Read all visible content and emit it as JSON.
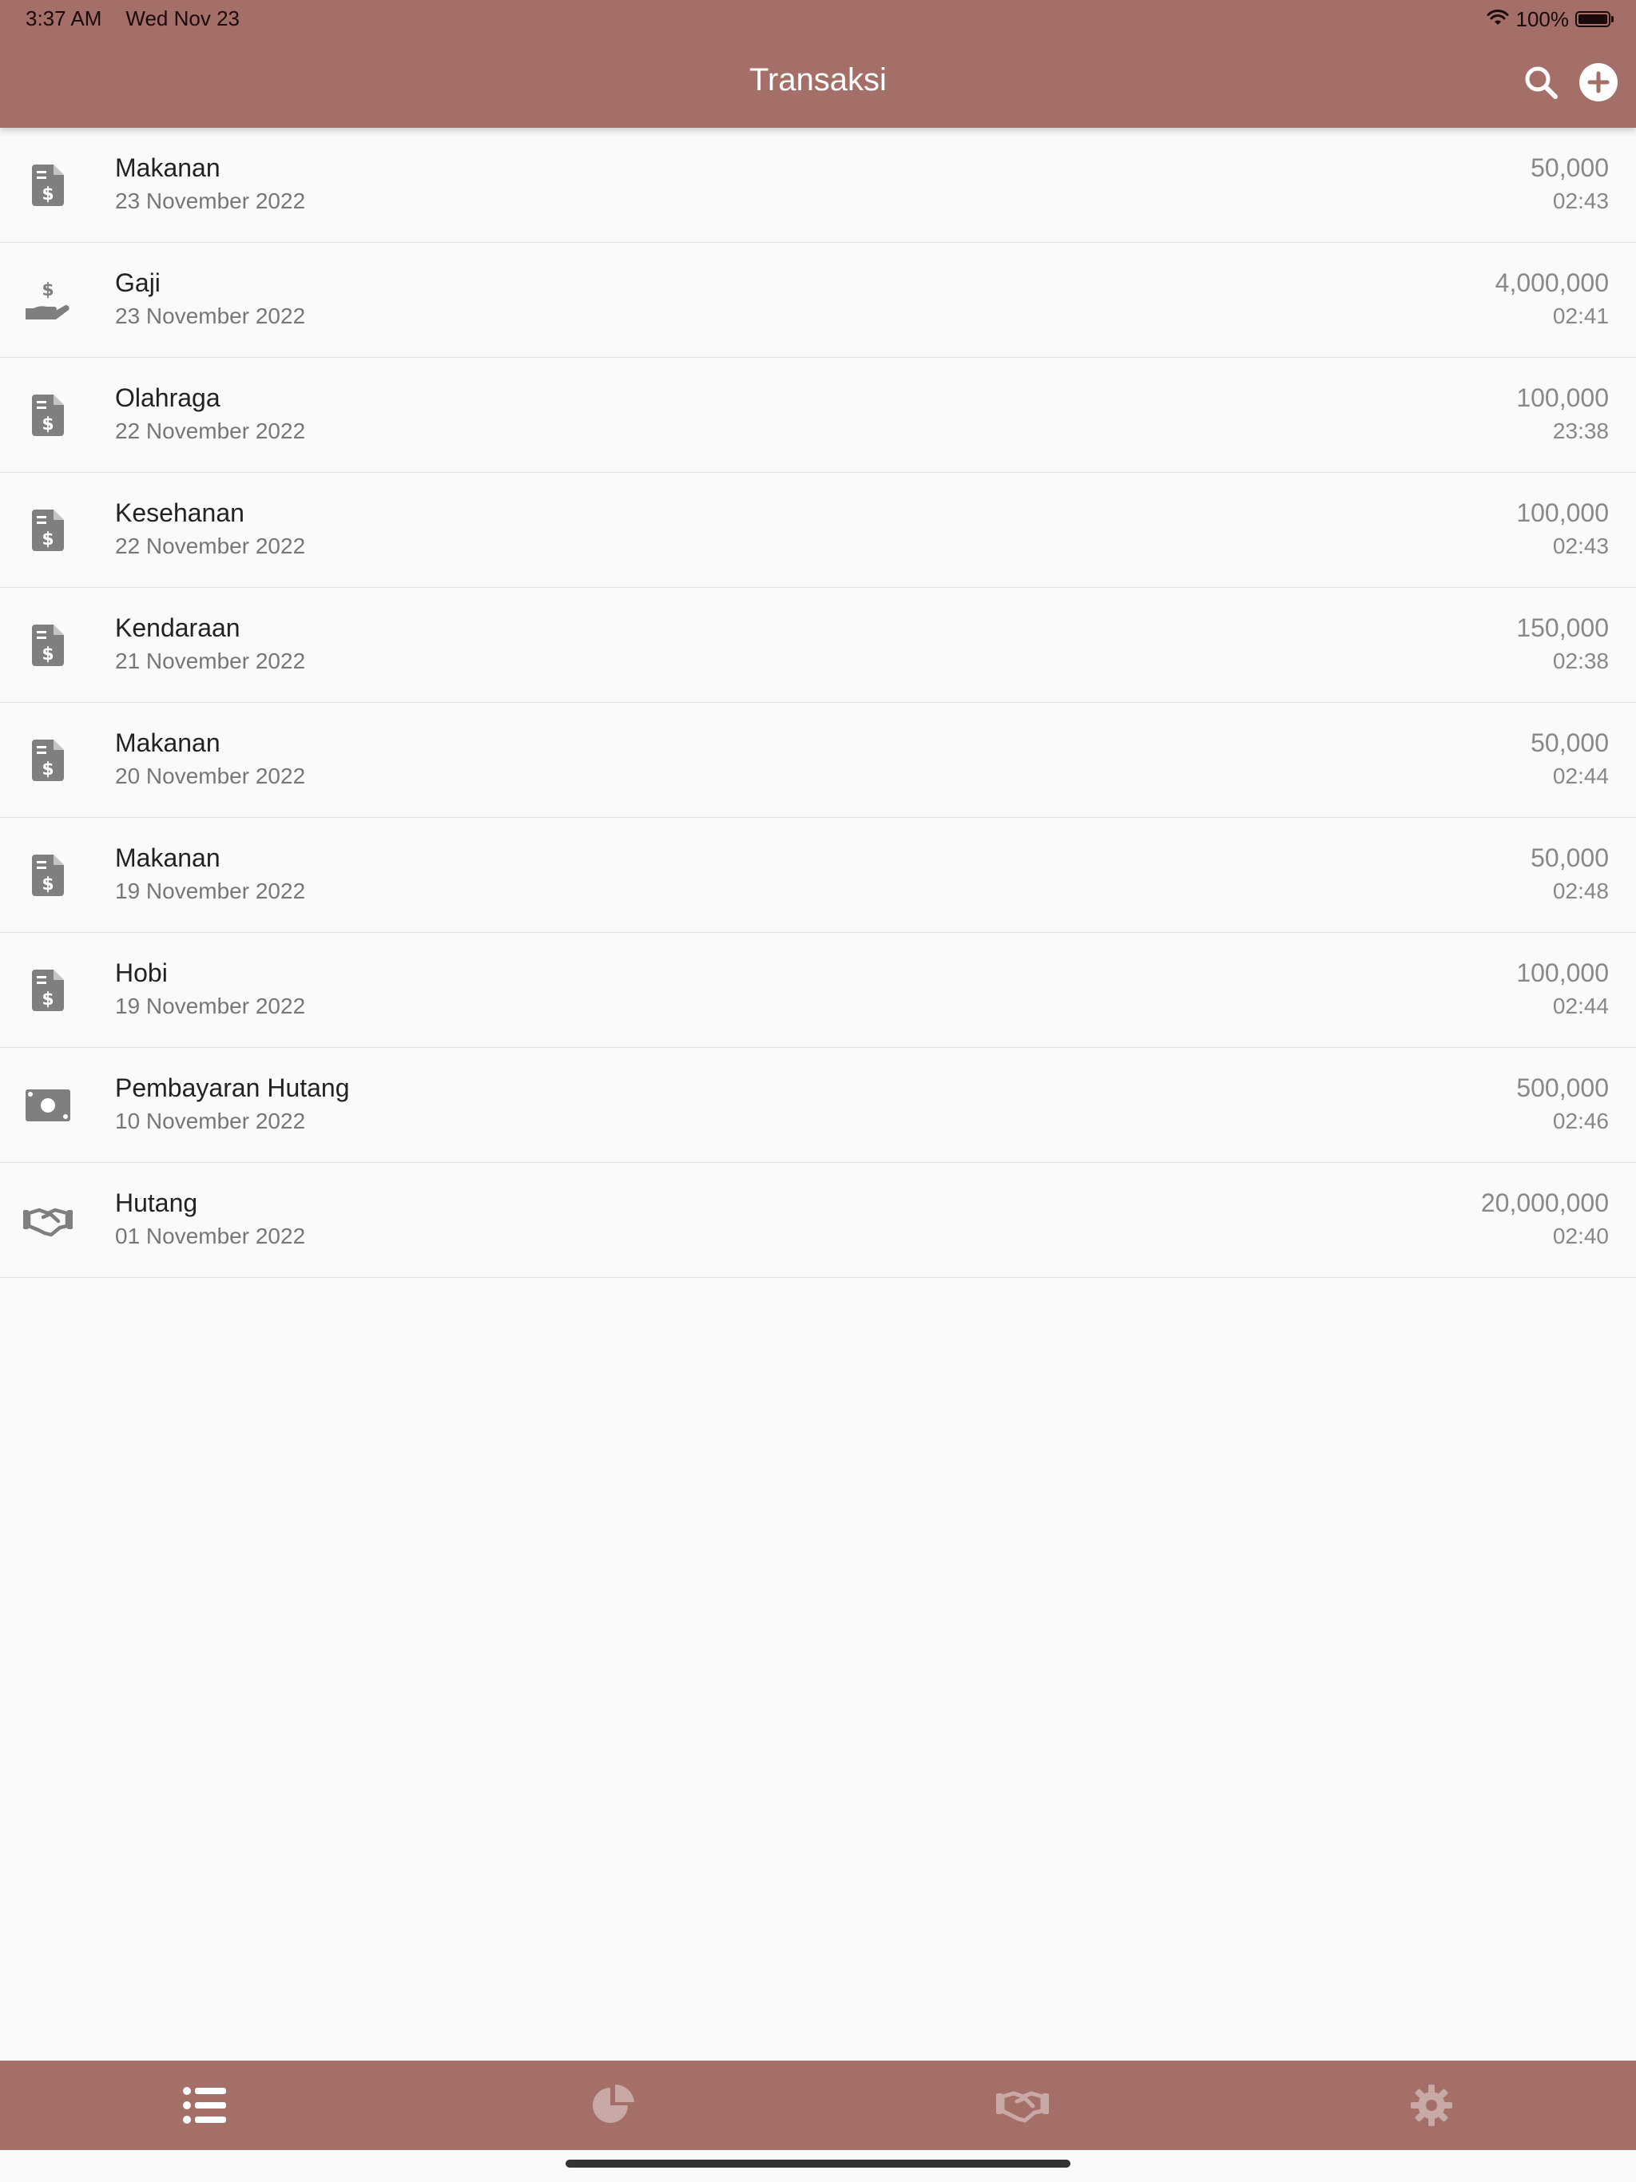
{
  "status_bar": {
    "time": "3:37 AM",
    "date": "Wed Nov 23",
    "battery": "100%"
  },
  "nav": {
    "title": "Transaksi",
    "actions": [
      "search-icon",
      "add-circle-icon"
    ]
  },
  "transactions": [
    {
      "icon": "receipt-dollar-icon",
      "title": "Makanan",
      "date": "23 November 2022",
      "amount": "50,000",
      "time": "02:43"
    },
    {
      "icon": "hand-holding-dollar-icon",
      "title": "Gaji",
      "date": "23 November 2022",
      "amount": "4,000,000",
      "time": "02:41"
    },
    {
      "icon": "receipt-dollar-icon",
      "title": "Olahraga",
      "date": "22 November 2022",
      "amount": "100,000",
      "time": "23:38"
    },
    {
      "icon": "receipt-dollar-icon",
      "title": "Kesehanan",
      "date": "22 November 2022",
      "amount": "100,000",
      "time": "02:43"
    },
    {
      "icon": "receipt-dollar-icon",
      "title": "Kendaraan",
      "date": "21 November 2022",
      "amount": "150,000",
      "time": "02:38"
    },
    {
      "icon": "receipt-dollar-icon",
      "title": "Makanan",
      "date": "20 November 2022",
      "amount": "50,000",
      "time": "02:44"
    },
    {
      "icon": "receipt-dollar-icon",
      "title": "Makanan",
      "date": "19 November 2022",
      "amount": "50,000",
      "time": "02:48"
    },
    {
      "icon": "receipt-dollar-icon",
      "title": "Hobi",
      "date": "19 November 2022",
      "amount": "100,000",
      "time": "02:44"
    },
    {
      "icon": "money-bill-icon",
      "title": "Pembayaran Hutang",
      "date": "10 November 2022",
      "amount": "500,000",
      "time": "02:46"
    },
    {
      "icon": "handshake-icon",
      "title": "Hutang",
      "date": "01 November 2022",
      "amount": "20,000,000",
      "time": "02:40"
    }
  ],
  "tabs": [
    {
      "icon": "list-icon",
      "active": true
    },
    {
      "icon": "pie-chart-icon",
      "active": false
    },
    {
      "icon": "handshake-icon",
      "active": false
    },
    {
      "icon": "gear-icon",
      "active": false
    }
  ],
  "colors": {
    "bar": "#a46f69",
    "background": "#fafafa",
    "icon": "#7f7f7f",
    "tab_active": "#ffffff",
    "tab_inactive": "#c9a9a5"
  }
}
